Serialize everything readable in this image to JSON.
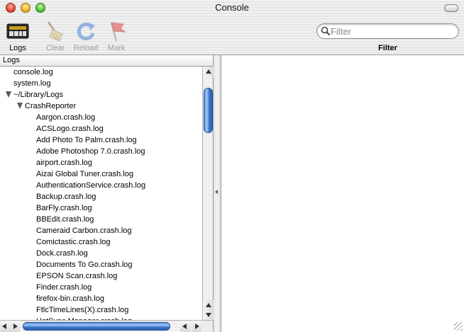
{
  "window": {
    "title": "Console"
  },
  "toolbar": {
    "logs_label": "Logs",
    "logs_icon": "log-monitor-icon",
    "clear_label": "Clear",
    "clear_icon": "broom-icon",
    "reload_label": "Reload",
    "reload_icon": "reload-icon",
    "mark_label": "Mark",
    "mark_icon": "flag-icon",
    "filter_placeholder": "Filter",
    "filter_value": "",
    "filter_label": "Filter"
  },
  "sidebar": {
    "header": "Logs",
    "items": [
      {
        "label": "console.log",
        "level": 0,
        "disclosure": "none"
      },
      {
        "label": "system.log",
        "level": 0,
        "disclosure": "none"
      },
      {
        "label": "~/Library/Logs",
        "level": 0,
        "disclosure": "expanded"
      },
      {
        "label": "CrashReporter",
        "level": 1,
        "disclosure": "expanded"
      },
      {
        "label": "Aargon.crash.log",
        "level": 2,
        "disclosure": "none"
      },
      {
        "label": "ACSLogo.crash.log",
        "level": 2,
        "disclosure": "none"
      },
      {
        "label": "Add Photo To Palm.crash.log",
        "level": 2,
        "disclosure": "none"
      },
      {
        "label": "Adobe Photoshop 7.0.crash.log",
        "level": 2,
        "disclosure": "none"
      },
      {
        "label": "airport.crash.log",
        "level": 2,
        "disclosure": "none"
      },
      {
        "label": "Aizai Global Tuner.crash.log",
        "level": 2,
        "disclosure": "none"
      },
      {
        "label": "AuthenticationService.crash.log",
        "level": 2,
        "disclosure": "none"
      },
      {
        "label": "Backup.crash.log",
        "level": 2,
        "disclosure": "none"
      },
      {
        "label": "BarFly.crash.log",
        "level": 2,
        "disclosure": "none"
      },
      {
        "label": "BBEdit.crash.log",
        "level": 2,
        "disclosure": "none"
      },
      {
        "label": "Cameraid Carbon.crash.log",
        "level": 2,
        "disclosure": "none"
      },
      {
        "label": "Comictastic.crash.log",
        "level": 2,
        "disclosure": "none"
      },
      {
        "label": "Dock.crash.log",
        "level": 2,
        "disclosure": "none"
      },
      {
        "label": "Documents To Go.crash.log",
        "level": 2,
        "disclosure": "none"
      },
      {
        "label": "EPSON Scan.crash.log",
        "level": 2,
        "disclosure": "none"
      },
      {
        "label": "Finder.crash.log",
        "level": 2,
        "disclosure": "none"
      },
      {
        "label": "firefox-bin.crash.log",
        "level": 2,
        "disclosure": "none"
      },
      {
        "label": "FtlcTimeLines(X).crash.log",
        "level": 2,
        "disclosure": "none"
      },
      {
        "label": "HotSync Manager.crash.log",
        "level": 2,
        "disclosure": "none"
      }
    ]
  },
  "colors": {
    "scroll_thumb": "#3f78c9",
    "disabled_text": "#9b9b9b"
  }
}
